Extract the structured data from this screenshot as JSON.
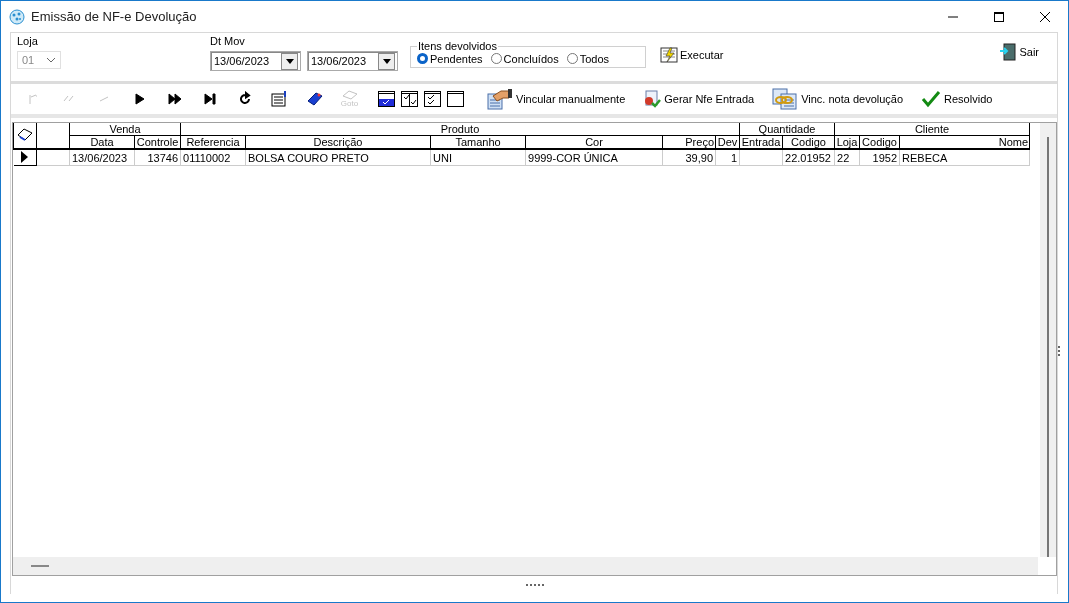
{
  "window": {
    "title": "Emissão de NF-e Devolução"
  },
  "filters": {
    "loja_label": "Loja",
    "loja_value": "01",
    "dt_label": "Dt Mov",
    "date_from": "13/06/2023",
    "date_to": "13/06/2023",
    "itens": {
      "title": "Itens devolvidos",
      "options": [
        {
          "label": "Pendentes",
          "selected": true
        },
        {
          "label": "Concluídos",
          "selected": false
        },
        {
          "label": "Todos",
          "selected": false
        }
      ]
    },
    "executar": "Executar",
    "sair": "Sair"
  },
  "nav": [
    {
      "kind": "first",
      "disabled": true
    },
    {
      "kind": "prior-page",
      "disabled": true
    },
    {
      "kind": "prior",
      "disabled": true
    },
    {
      "kind": "next",
      "disabled": false
    },
    {
      "kind": "next-page",
      "disabled": false
    },
    {
      "kind": "last",
      "disabled": false
    },
    {
      "kind": "refresh",
      "disabled": false
    },
    {
      "kind": "edit",
      "disabled": false
    },
    {
      "kind": "tag",
      "disabled": false
    },
    {
      "kind": "goto",
      "disabled": true,
      "label": "Goto"
    }
  ],
  "views": [
    {
      "kind": "check-one"
    },
    {
      "kind": "check-two"
    },
    {
      "kind": "check-all"
    },
    {
      "kind": "blank"
    }
  ],
  "actions": [
    {
      "kind": "hand",
      "label": "Vincular manualmente"
    },
    {
      "kind": "doc-check",
      "label": "Gerar Nfe Entrada"
    },
    {
      "kind": "link",
      "label": "Vinc. nota devolução"
    },
    {
      "kind": "check",
      "label": "Resolvido"
    }
  ],
  "grid": {
    "groups": [
      "Venda",
      "Produto",
      "Quantidade",
      "Cliente"
    ],
    "columns": [
      "Data",
      "Controle",
      "Referencia",
      "Descrição",
      "Tamanho",
      "Cor",
      "Preço",
      "Dev",
      "Entrada",
      "Codigo",
      "Loja",
      "Codigo",
      "Nome"
    ],
    "rows": [
      {
        "selected": true,
        "cells": [
          "13/06/2023",
          "13746",
          "01110002",
          "BOLSA COURO PRETO",
          "UNI",
          "9999-COR ÚNICA",
          "39,90",
          "1",
          "",
          "22.01952",
          "22",
          "1952",
          "REBECA"
        ]
      }
    ]
  }
}
